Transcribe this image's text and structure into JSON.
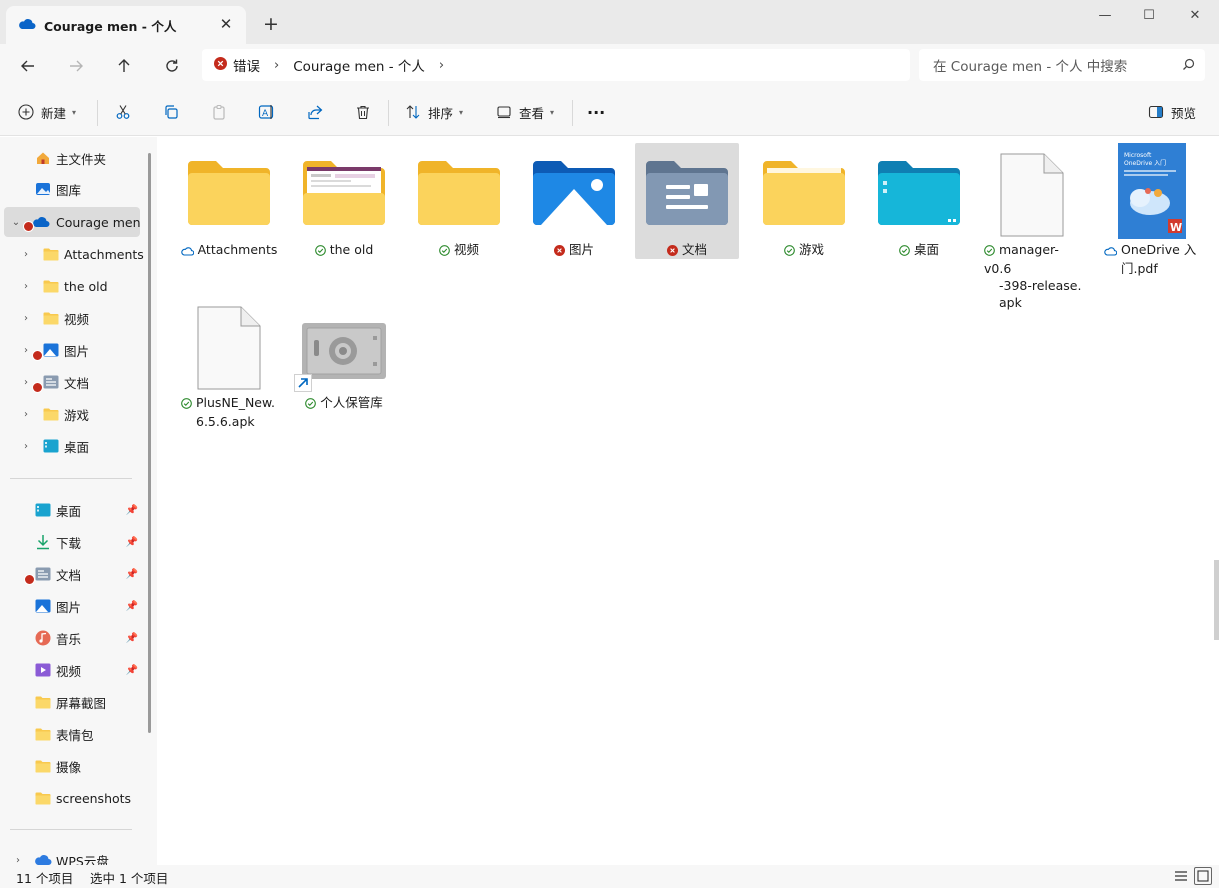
{
  "window": {
    "tab_title": "Courage men - 个人",
    "close_tab": "✕",
    "new_tab": "+",
    "minimize": "—",
    "maximize": "☐",
    "close": "✕"
  },
  "address": {
    "crumbs": [
      "错误",
      "Courage men - 个人"
    ],
    "search_placeholder": "在 Courage men - 个人 中搜索"
  },
  "toolbar": {
    "new_label": "新建",
    "sort_label": "排序",
    "view_label": "查看",
    "more_label": "···",
    "preview_label": "预览"
  },
  "sidebar": {
    "top": [
      {
        "label": "主文件夹",
        "icon": "home-icon"
      },
      {
        "label": "图库",
        "icon": "gallery-icon"
      }
    ],
    "onedrive": {
      "label": "Courage men",
      "icon": "cloud-icon",
      "status": "error"
    },
    "children": [
      {
        "label": "Attachments",
        "icon": "folder-icon"
      },
      {
        "label": "the old",
        "icon": "folder-icon"
      },
      {
        "label": "视频",
        "icon": "folder-icon"
      },
      {
        "label": "图片",
        "icon": "pictures-icon",
        "status": "error"
      },
      {
        "label": "文档",
        "icon": "documents-icon",
        "status": "error"
      },
      {
        "label": "游戏",
        "icon": "folder-icon"
      },
      {
        "label": "桌面",
        "icon": "desktop-icon"
      }
    ],
    "quick_access": [
      {
        "label": "桌面",
        "icon": "desktop-icon",
        "pinned": true
      },
      {
        "label": "下载",
        "icon": "download-icon",
        "pinned": true
      },
      {
        "label": "文档",
        "icon": "documents-icon",
        "pinned": true,
        "status": "error"
      },
      {
        "label": "图片",
        "icon": "pictures-icon",
        "pinned": true
      },
      {
        "label": "音乐",
        "icon": "music-icon",
        "pinned": true
      },
      {
        "label": "视频",
        "icon": "video-icon",
        "pinned": true
      },
      {
        "label": "屏幕截图",
        "icon": "folder-icon"
      },
      {
        "label": "表情包",
        "icon": "folder-icon"
      },
      {
        "label": "摄像",
        "icon": "folder-icon"
      },
      {
        "label": "screenshots",
        "icon": "folder-icon"
      }
    ],
    "wps": {
      "label": "WPS云盘",
      "icon": "cloud-icon"
    }
  },
  "files": [
    {
      "name": "Attachments",
      "type": "folder",
      "status": "cloud"
    },
    {
      "name": "the old",
      "type": "folder-preview",
      "status": "synced"
    },
    {
      "name": "视频",
      "type": "folder",
      "status": "synced"
    },
    {
      "name": "图片",
      "type": "pictures",
      "status": "error"
    },
    {
      "name": "文档",
      "type": "documents",
      "status": "error",
      "selected": true
    },
    {
      "name": "游戏",
      "type": "folder",
      "status": "synced"
    },
    {
      "name": "桌面",
      "type": "desktop",
      "status": "synced"
    },
    {
      "name": "manager-v0.6-398-release.apk",
      "name_lines": [
        "manager-v0.6",
        "-398-release.",
        "apk"
      ],
      "type": "file",
      "status": "synced"
    },
    {
      "name": "OneDrive 入门.pdf",
      "name_lines": [
        "OneDrive 入",
        "门.pdf"
      ],
      "type": "pdf",
      "status": "cloud",
      "thumb_title": [
        "Microsoft",
        "OneDrive 入门"
      ]
    },
    {
      "name": "PlusNE_New.6.5.6.apk",
      "name_lines": [
        "PlusNE_New.",
        "6.5.6.apk"
      ],
      "type": "file",
      "status": "synced"
    },
    {
      "name": "个人保管库",
      "type": "vault",
      "status": "synced",
      "shortcut": true
    }
  ],
  "status": {
    "count": "11 个项目",
    "selected": "选中 1 个项目"
  },
  "colors": {
    "accent": "#0067c0",
    "error": "#c42b1c",
    "synced": "#2d8a2d",
    "folder": "#f8c94e"
  }
}
